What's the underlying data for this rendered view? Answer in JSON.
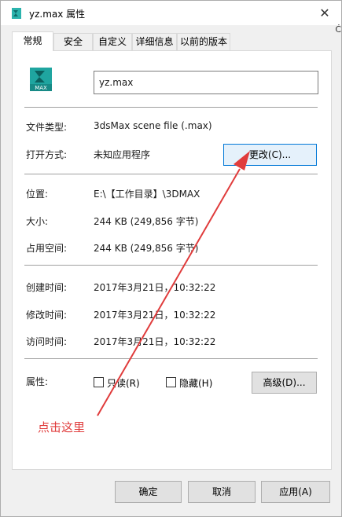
{
  "window": {
    "title": "yz.max 属性",
    "close_glyph": "✕",
    "edge_glyph": "Ċ"
  },
  "tabs": [
    {
      "label": "常规"
    },
    {
      "label": "安全"
    },
    {
      "label": "自定义"
    },
    {
      "label": "详细信息"
    },
    {
      "label": "以前的版本"
    }
  ],
  "file": {
    "icon": "3ds-max-file-icon",
    "icon_text": "MAX",
    "name": "yz.max"
  },
  "general": {
    "type_label": "文件类型:",
    "type_value": "3dsMax scene file (.max)",
    "opens_with_label": "打开方式:",
    "opens_with_value": "未知应用程序",
    "change_button": "更改(C)...",
    "location_label": "位置:",
    "location_value": "E:\\【工作目录】\\3DMAX",
    "size_label": "大小:",
    "size_value": "244 KB (249,856 字节)",
    "size_on_disk_label": "占用空间:",
    "size_on_disk_value": "244 KB (249,856 字节)",
    "created_label": "创建时间:",
    "created_value": "2017年3月21日，10:32:22",
    "modified_label": "修改时间:",
    "modified_value": "2017年3月21日，10:32:22",
    "accessed_label": "访问时间:",
    "accessed_value": "2017年3月21日，10:32:22",
    "attributes_label": "属性:",
    "readonly_label": "只读(R)",
    "readonly_checked": false,
    "hidden_label": "隐藏(H)",
    "hidden_checked": false,
    "advanced_button": "高级(D)..."
  },
  "annotation": {
    "text": "点击这里",
    "color": "#e03c3c"
  },
  "footer": {
    "ok": "确定",
    "cancel": "取消",
    "apply": "应用(A)"
  },
  "colors": {
    "focus_border": "#0078d7",
    "icon_teal": "#1fa5a0"
  }
}
